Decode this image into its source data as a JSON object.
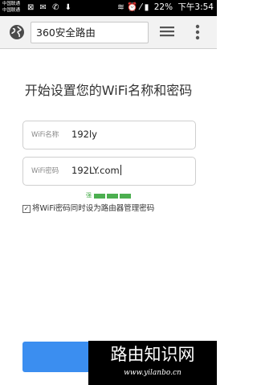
{
  "status_bar": {
    "carrier_line1": "中国联通",
    "carrier_line2": "中国联通",
    "left_icons": "⊠ ✉ ✆ ⬇",
    "right_icons": "≋ ⏰ ⁄ ▮",
    "battery": "22%",
    "time": "下午3:54"
  },
  "browser": {
    "url": "360安全路由"
  },
  "setup": {
    "title": "开始设置您的WiFi名称和密码",
    "ssid_label": "WiFi名称",
    "ssid_value": "192ly",
    "password_label": "WiFi密码",
    "password_value": "192LY.com",
    "strength_label": "强",
    "strength_level": 3,
    "sync_checkbox_checked": true,
    "sync_checkbox_label": "将WiFi密码同时设为路由器管理密码"
  },
  "watermark": {
    "title": "路由知识网",
    "url": "www.yilanbo.cn"
  },
  "colors": {
    "accent": "#3b8ef0",
    "strength": "#4caf50"
  }
}
